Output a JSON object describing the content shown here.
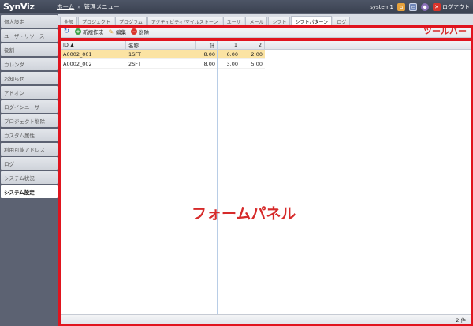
{
  "header": {
    "logo": "SynViz",
    "home_link": "ホーム",
    "separator": "»",
    "current": "管理メニュー",
    "user": "system1",
    "logout": "ログアウト"
  },
  "sidebar": {
    "items": [
      {
        "label": "個人設定"
      },
      {
        "label": "ユーザ・リソース"
      },
      {
        "label": "役割"
      },
      {
        "label": "カレンダ"
      },
      {
        "label": "お知らせ"
      },
      {
        "label": "アドオン"
      },
      {
        "label": "ログインユーザ"
      },
      {
        "label": "プロジェクト削除"
      },
      {
        "label": "カスタム属性"
      },
      {
        "label": "利用可能アドレス"
      },
      {
        "label": "ログ"
      },
      {
        "label": "システム状況"
      },
      {
        "label": "システム設定"
      }
    ]
  },
  "tabs": [
    {
      "label": "全般"
    },
    {
      "label": "プロジェクト"
    },
    {
      "label": "プログラム"
    },
    {
      "label": "アクティビティ/マイルストーン"
    },
    {
      "label": "ユーザ"
    },
    {
      "label": "メール"
    },
    {
      "label": "シフト"
    },
    {
      "label": "シフトパターン"
    },
    {
      "label": "ログ"
    }
  ],
  "toolbar": {
    "new_label": "新規作成",
    "edit_label": "編集",
    "delete_label": "削除",
    "annotation": "ツールバー"
  },
  "grid": {
    "headers": {
      "id": "ID",
      "name": "名称",
      "total": "計",
      "col1": "1",
      "col2": "2"
    },
    "rows": [
      {
        "id": "A0002_001",
        "name": "1SFT",
        "total": "8.00",
        "col1": "6.00",
        "col2": "2.00"
      },
      {
        "id": "A0002_002",
        "name": "2SFT",
        "total": "8.00",
        "col1": "3.00",
        "col2": "5.00"
      }
    ],
    "annotation": "フォームパネル",
    "count": "2 件"
  },
  "colors": {
    "accent": "#e0141e",
    "selected_row": "#fbe3a3"
  }
}
